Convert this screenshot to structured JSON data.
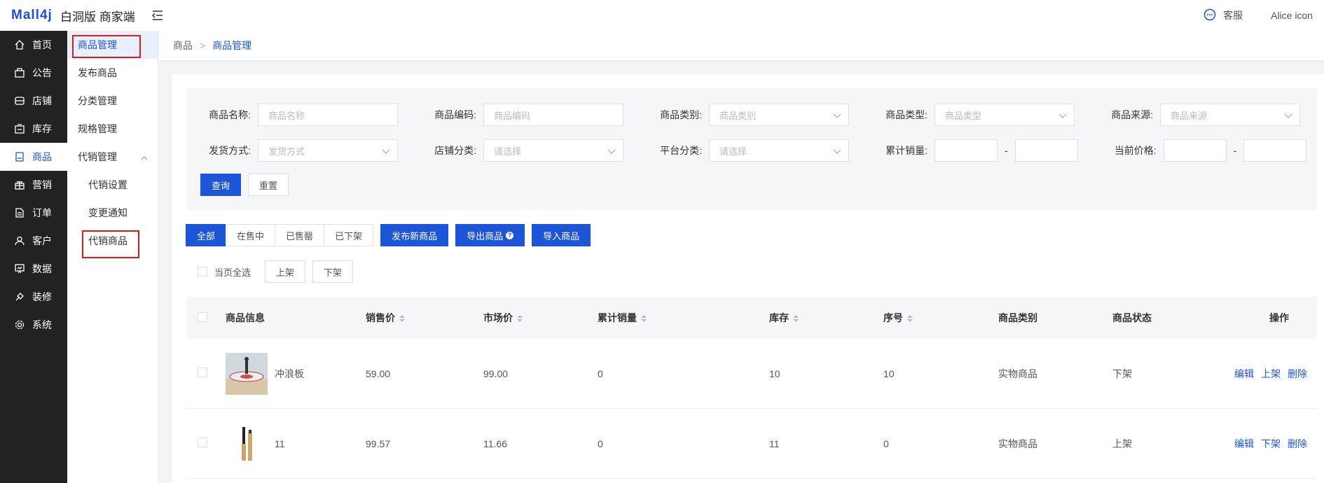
{
  "header": {
    "logo": "Mall4j",
    "title": "白洞版 商家端",
    "service_label": "客服",
    "user_label": "Alice icon"
  },
  "nav": [
    {
      "label": "首页",
      "icon": "home-icon"
    },
    {
      "label": "公告",
      "icon": "notice-icon"
    },
    {
      "label": "店铺",
      "icon": "shop-icon"
    },
    {
      "label": "库存",
      "icon": "stock-icon"
    },
    {
      "label": "商品",
      "icon": "goods-icon",
      "active": true
    },
    {
      "label": "营销",
      "icon": "gift-icon"
    },
    {
      "label": "订单",
      "icon": "order-icon"
    },
    {
      "label": "客户",
      "icon": "user-icon"
    },
    {
      "label": "数据",
      "icon": "data-icon"
    },
    {
      "label": "装修",
      "icon": "decorate-icon"
    },
    {
      "label": "系统",
      "icon": "settings-icon"
    }
  ],
  "subnav": {
    "items": [
      "商品管理",
      "发布商品",
      "分类管理",
      "规格管理",
      "代销管理"
    ],
    "children": [
      "代销设置",
      "变更通知",
      "代销商品"
    ]
  },
  "breadcrumb": [
    "商品",
    "商品管理"
  ],
  "filter": {
    "row1": [
      {
        "label": "商品名称:",
        "placeholder": "商品名称",
        "select": false
      },
      {
        "label": "商品编码:",
        "placeholder": "商品编码",
        "select": false
      },
      {
        "label": "商品类别:",
        "placeholder": "商品类别",
        "select": true
      },
      {
        "label": "商品类型:",
        "placeholder": "商品类型",
        "select": true
      },
      {
        "label": "商品来源:",
        "placeholder": "商品来源",
        "select": true
      }
    ],
    "row2": [
      {
        "label": "发货方式:",
        "placeholder": "发货方式"
      },
      {
        "label": "店铺分类:",
        "placeholder": "请选择"
      },
      {
        "label": "平台分类:",
        "placeholder": "请选择"
      }
    ],
    "sales_label": "累计销量:",
    "price_label": "当前价格:",
    "range_sep": "-",
    "query": "查询",
    "reset": "重置"
  },
  "tabs": [
    "全部",
    "在售中",
    "已售罄",
    "已下架"
  ],
  "actions": {
    "publish": "发布新商品",
    "export": "导出商品",
    "export_help": "?",
    "import": "导入商品"
  },
  "batch": {
    "select_all": "当页全选",
    "on": "上架",
    "off": "下架"
  },
  "table": {
    "headers": [
      "商品信息",
      "销售价",
      "市场价",
      "累计销量",
      "库存",
      "序号",
      "商品类别",
      "商品状态",
      "操作"
    ],
    "rows": [
      {
        "name": "冲浪板",
        "price": "59.00",
        "market": "99.00",
        "sales": "0",
        "stock": "10",
        "seq": "10",
        "category": "实物商品",
        "status": "下架",
        "ops": [
          "编辑",
          "上架",
          "删除"
        ]
      },
      {
        "name": "11",
        "price": "99.57",
        "market": "11.66",
        "sales": "0",
        "stock": "11",
        "seq": "0",
        "category": "实物商品",
        "status": "上架",
        "ops": [
          "编辑",
          "下架",
          "删除"
        ]
      }
    ]
  },
  "colors": {
    "accent": "#1d55d8",
    "highlight": "#e0191b",
    "nav_bg": "#222222"
  }
}
